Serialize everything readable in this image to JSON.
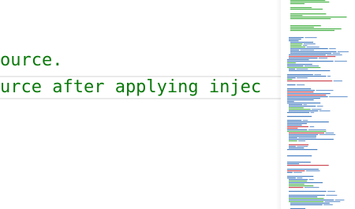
{
  "editor": {
    "lines": [
      {
        "text": "ource."
      },
      {
        "text": "urce after applying injec"
      }
    ]
  },
  "colors": {
    "comment_green": "#0b7a0b",
    "minimap_code": "#1a5fb4",
    "minimap_comment": "#2aa52a",
    "minimap_string": "#c01c28",
    "line_highlight": "#eaeaea",
    "background": "#ffffff"
  }
}
